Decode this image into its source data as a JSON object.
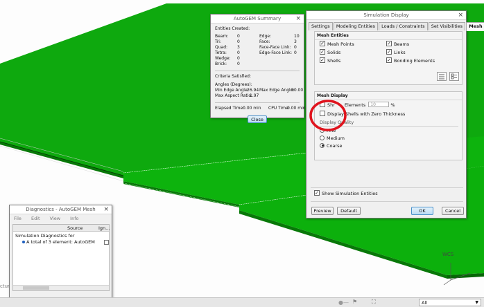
{
  "summary": {
    "title": "AutoGEM Summary",
    "entities_created": "Entities Created:",
    "stats": [
      {
        "label": "Beam:",
        "value": "0",
        "label2": "Edge:",
        "value2": "10"
      },
      {
        "label": "Tri:",
        "value": "0",
        "label2": "Face:",
        "value2": "3"
      },
      {
        "label": "Quad:",
        "value": "3",
        "label2": "Face-Face Link:",
        "value2": "0"
      },
      {
        "label": "Tetra:",
        "value": "0",
        "label2": "Edge-Face Link:",
        "value2": "0"
      },
      {
        "label": "Wedge:",
        "value": "0",
        "label2": "",
        "value2": ""
      },
      {
        "label": "Brick:",
        "value": "0",
        "label2": "",
        "value2": ""
      }
    ],
    "criteria": "Criteria Satisfied:",
    "angles": "Angles (Degrees):",
    "min_edge_label": "Min Edge Angle:",
    "min_edge": "26.94",
    "max_edge_label": "Max Edge Angle:",
    "max_edge": "90.00",
    "max_aspect_label": "Max Aspect Ratio:",
    "max_aspect": "1.97",
    "elapsed_label": "Elapsed Time:",
    "elapsed": "0.00 min",
    "cpu_label": "CPU Time:",
    "cpu": "0.00 min",
    "close": "Close"
  },
  "simdisplay": {
    "title": "Simulation Display",
    "tabs": [
      "Settings",
      "Modeling Entities",
      "Loads / Constraints",
      "Set Visibilities",
      "Mesh"
    ],
    "mesh_entities": "Mesh Entities",
    "entities": [
      {
        "label": "Mesh Points",
        "checked": true
      },
      {
        "label": "Beams",
        "checked": true
      },
      {
        "label": "Solids",
        "checked": true
      },
      {
        "label": "Links",
        "checked": true
      },
      {
        "label": "Shells",
        "checked": true
      },
      {
        "label": "Bonding Elements",
        "checked": true
      }
    ],
    "mesh_display": "Mesh Display",
    "shrink_label_a": "Shr",
    "shrink_label_b": "Elements",
    "shrink_value": "10",
    "shrink_unit": "%",
    "zero_thickness_a": "Display",
    "zero_thickness_b": "Shells with Zero Thickness",
    "quality_label": "Display Quality",
    "qualities": [
      {
        "label": "Fine",
        "selected": false
      },
      {
        "label": "Medium",
        "selected": false
      },
      {
        "label": "Coarse",
        "selected": true
      }
    ],
    "show_sim": "Show Simulation Entities",
    "preview": "Preview",
    "default": "Default",
    "ok": "OK",
    "cancel": "Cancel"
  },
  "diag": {
    "title": "Diagnostics - AutoGEM Mesh",
    "menu": [
      "File",
      "Edit",
      "View",
      "Info"
    ],
    "col_source": "Source",
    "col_ign": "Ign...",
    "row1": "Simulation Diagnostics for",
    "row2": "A total of 3 element: AutoGEM"
  },
  "viewport": {
    "csys_label": "WCS",
    "left_cut_text": "cture"
  },
  "statusbar": {
    "filter": "All"
  },
  "colors": {
    "mesh_green": "#0dac0d",
    "mesh_side": "#087a08",
    "highlight_circle": "#e0141e",
    "button_blue": "#bcdcf4"
  }
}
